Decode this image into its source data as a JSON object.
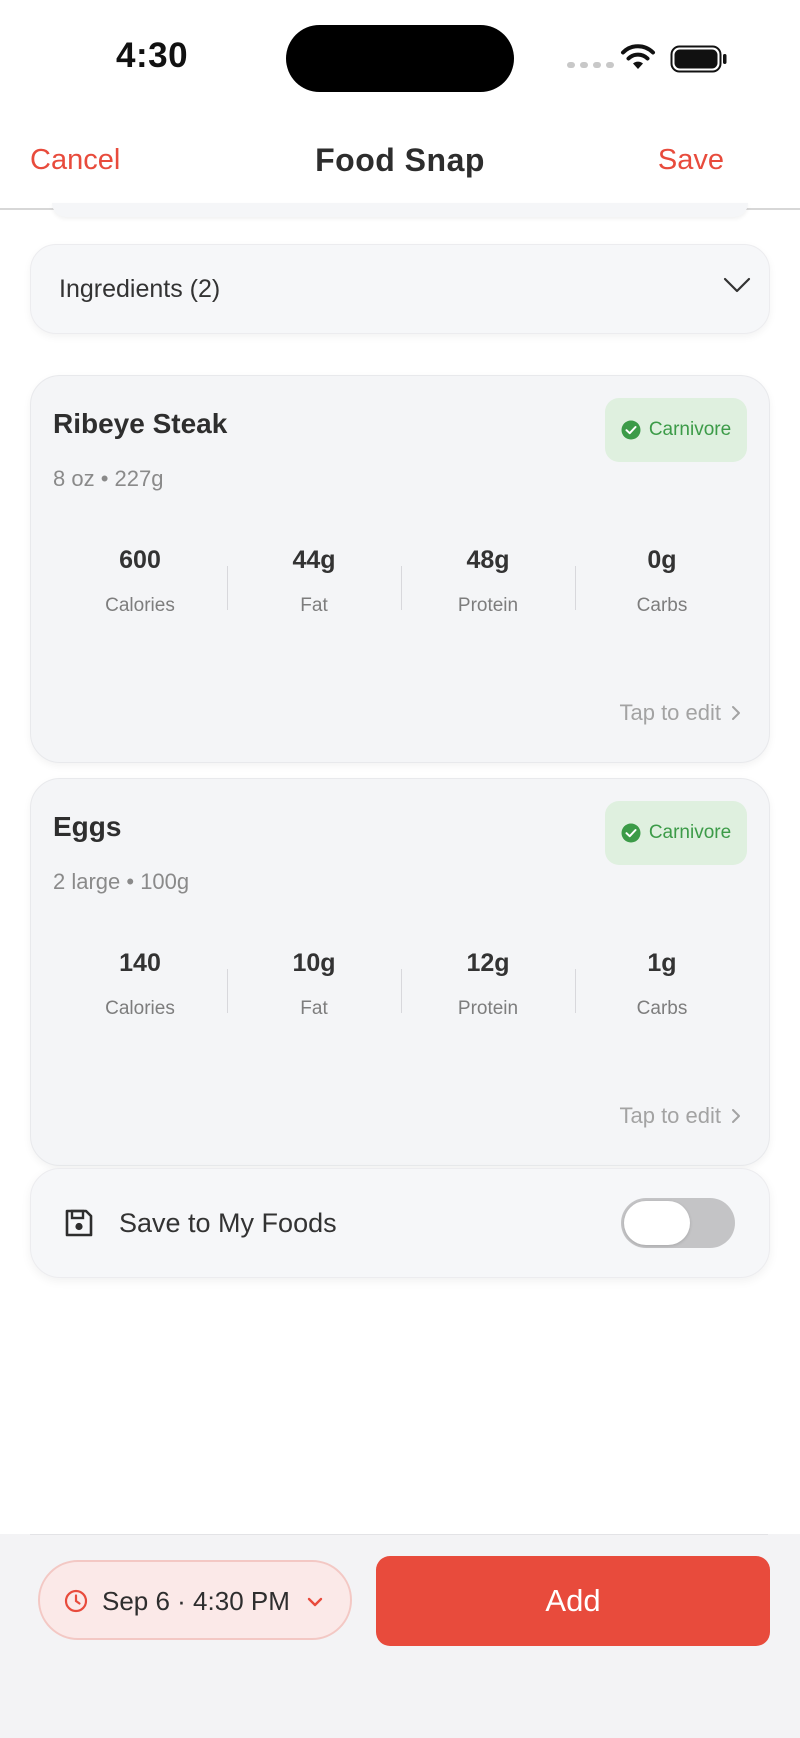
{
  "status_bar": {
    "time": "4:30"
  },
  "nav": {
    "cancel_label": "Cancel",
    "title": "Food Snap",
    "save_label": "Save"
  },
  "ingredients": {
    "header_label": "Ingredients (2)"
  },
  "foods": [
    {
      "name": "Ribeye Steak",
      "serving": "8 oz • 227g",
      "badge": "Carnivore",
      "stats": [
        {
          "value": "600",
          "label": "Calories"
        },
        {
          "value": "44g",
          "label": "Fat"
        },
        {
          "value": "48g",
          "label": "Protein"
        },
        {
          "value": "0g",
          "label": "Carbs"
        }
      ],
      "edit_label": "Tap to edit"
    },
    {
      "name": "Eggs",
      "serving": "2 large • 100g",
      "badge": "Carnivore",
      "stats": [
        {
          "value": "140",
          "label": "Calories"
        },
        {
          "value": "10g",
          "label": "Fat"
        },
        {
          "value": "12g",
          "label": "Protein"
        },
        {
          "value": "1g",
          "label": "Carbs"
        }
      ],
      "edit_label": "Tap to edit"
    }
  ],
  "save_to_foods": {
    "label": "Save to My Foods",
    "enabled": false
  },
  "bottom": {
    "datetime_label": "Sep 6 · 4:30 PM",
    "add_label": "Add"
  },
  "colors": {
    "accent": "#e84b3c",
    "badge_bg": "#dff0df",
    "badge_text": "#3c9b48"
  },
  "icons": [
    "wifi-icon",
    "battery-icon",
    "chevron-down-icon",
    "check-circle-icon",
    "chevron-right-icon",
    "floppy-disk-icon",
    "clock-icon"
  ]
}
